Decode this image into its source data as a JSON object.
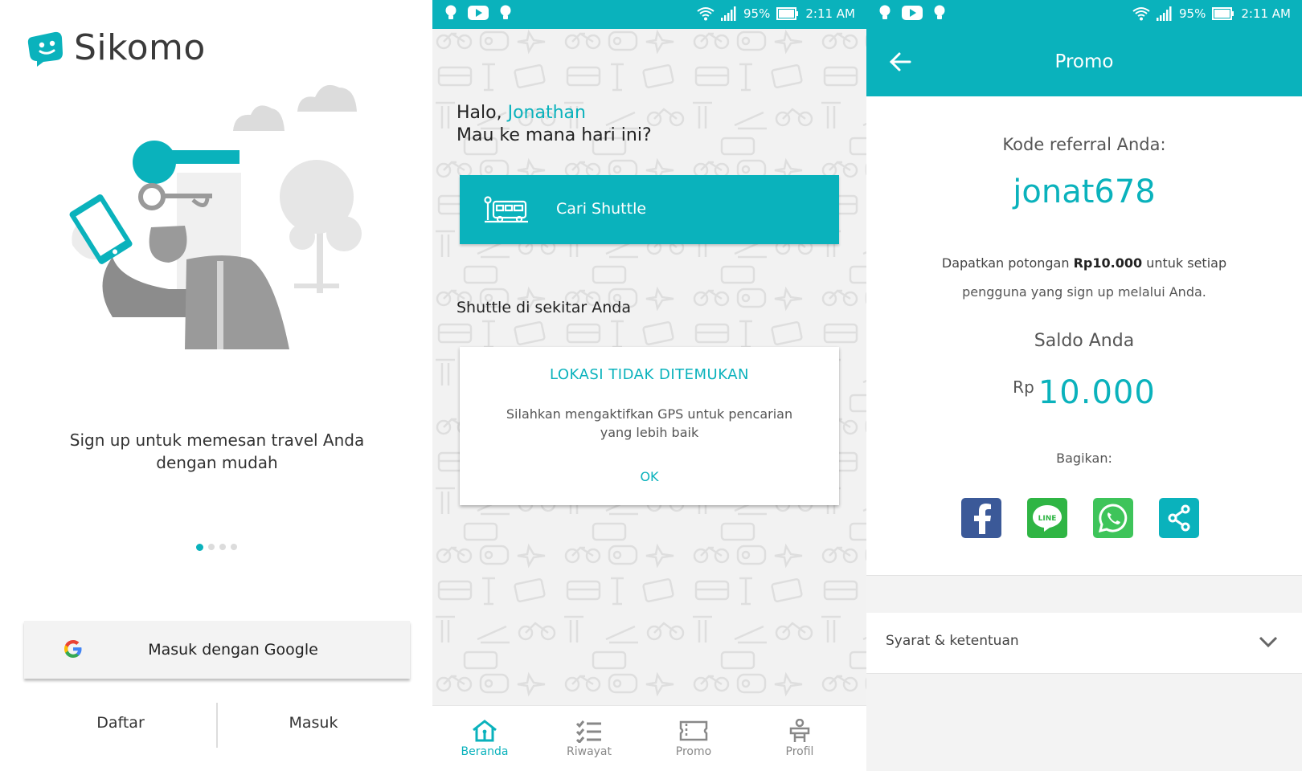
{
  "colors": {
    "brand": "#0ab2bc",
    "facebook": "#3b5998",
    "line": "#2fb544",
    "whatsapp": "#3ec45a"
  },
  "status_bar": {
    "battery": "95%",
    "time": "2:11 AM"
  },
  "onboarding": {
    "app_name": "Sikomo",
    "tagline": "Sign up untuk memesan travel Anda dengan mudah",
    "page_count": 4,
    "active_page": 1,
    "google_button": "Masuk dengan Google",
    "register": "Daftar",
    "login": "Masuk"
  },
  "home": {
    "greeting": "Halo, ",
    "user_name": "Jonathan",
    "question": "Mau ke mana hari ini?",
    "search_shuttle": "Cari Shuttle",
    "nearby_title": "Shuttle di sekitar Anda",
    "dialog": {
      "title": "LOKASI TIDAK DITEMUKAN",
      "message": "Silahkan mengaktifkan GPS untuk pencarian yang lebih baik",
      "ok": "OK"
    },
    "nav": [
      {
        "label": "Beranda",
        "icon": "home-icon",
        "active": true
      },
      {
        "label": "Riwayat",
        "icon": "list-icon",
        "active": false
      },
      {
        "label": "Promo",
        "icon": "ticket-icon",
        "active": false
      },
      {
        "label": "Profil",
        "icon": "profile-icon",
        "active": false
      }
    ]
  },
  "promo": {
    "title": "Promo",
    "referral_label": "Kode referral Anda:",
    "referral_code": "jonat678",
    "desc_prefix": "Dapatkan potongan ",
    "desc_amount": "Rp10.000",
    "desc_suffix": " untuk setiap",
    "desc_line2": "pengguna yang sign up melalui Anda.",
    "balance_label": "Saldo Anda",
    "balance_currency": "Rp",
    "balance_amount": "10.000",
    "share_label": "Bagikan:",
    "share_targets": [
      "facebook-icon",
      "line-icon",
      "whatsapp-icon",
      "share-icon"
    ],
    "terms": "Syarat & ketentuan"
  }
}
